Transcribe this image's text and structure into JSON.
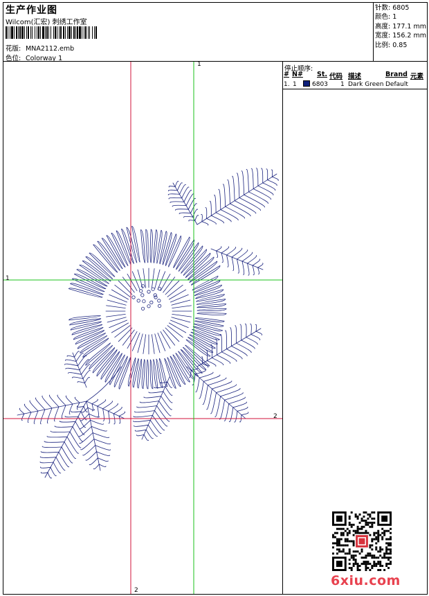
{
  "header": {
    "title": "生产作业图",
    "subtitle": "Wilcom(汇宏) 刺绣工作室",
    "file_label": "花版:",
    "file_value": "MNA2112.emb",
    "colorway_label": "色位:",
    "colorway_value": "Colorway 1"
  },
  "stats": {
    "stitches_label": "针数:",
    "stitches": "6805",
    "colors_label": "颜色:",
    "colors": "1",
    "height_label": "高度:",
    "height": "177.1 mm",
    "width_label": "宽度:",
    "width": "156.2 mm",
    "scale_label": "比例:",
    "scale": "0.85"
  },
  "stop_sequence": {
    "title": "停止顺序:",
    "columns": [
      "#",
      "N#",
      "St.",
      "代码",
      "描述",
      "Brand",
      "元素"
    ],
    "rows": [
      {
        "num": "1.",
        "n": "1",
        "swatch_color": "#0d1f7a",
        "stitches": "6803",
        "code": "1",
        "description": "Dark Green",
        "brand": "Default"
      }
    ]
  },
  "guides": {
    "green_vertical": "1",
    "green_horizontal": "1",
    "red_vertical": "2",
    "red_horizontal": "2"
  },
  "colors": {
    "thread": "#1a237e",
    "guide_red": "#d0103a",
    "guide_green": "#18c21a",
    "watermark": "#e8424f"
  },
  "watermark": {
    "text": "6xiu.com",
    "qr_icon": "qr-code-icon"
  }
}
